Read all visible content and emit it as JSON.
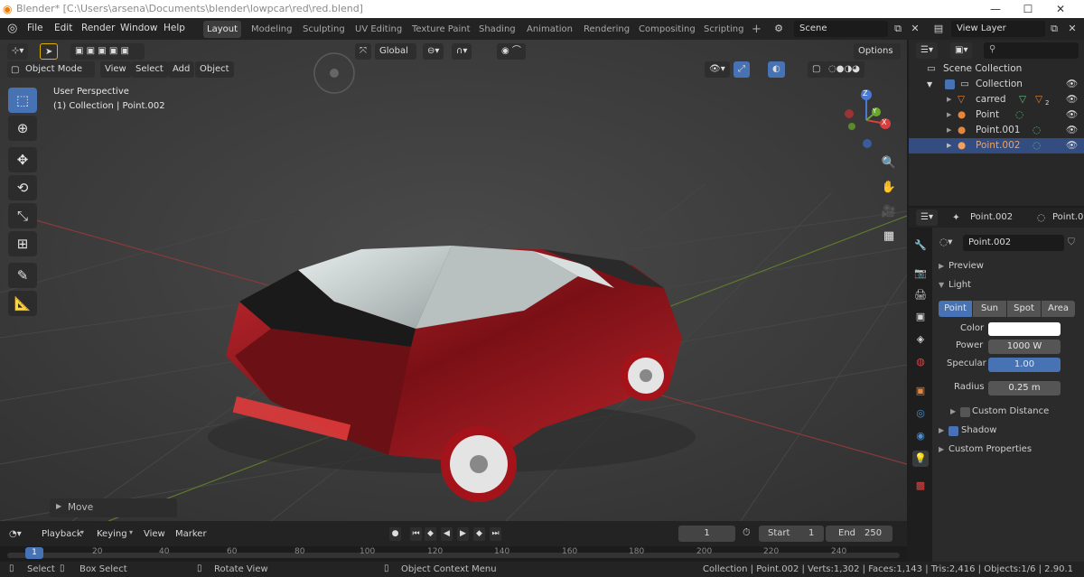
{
  "window": {
    "title": "Blender* [C:\\Users\\arsena\\Documents\\blender\\lowpcar\\red\\red.blend]",
    "controls": [
      "—",
      "☐",
      "✕"
    ]
  },
  "menu": [
    "File",
    "Edit",
    "Render",
    "Window",
    "Help"
  ],
  "workspaces": [
    "Layout",
    "Modeling",
    "Sculpting",
    "UV Editing",
    "Texture Paint",
    "Shading",
    "Animation",
    "Rendering",
    "Compositing",
    "Scripting"
  ],
  "workspace_add": "+",
  "scene": {
    "name": "Scene"
  },
  "view_layer": {
    "name": "View Layer"
  },
  "viewport": {
    "transform_orientation": "Global",
    "options_label": "Options",
    "mode": "Object Mode",
    "menu": [
      "View",
      "Select",
      "Add",
      "Object"
    ],
    "overlay_lines": [
      "User Perspective",
      "(1) Collection | Point.002"
    ],
    "operator_panel": "Move",
    "gizmo_axes": [
      "X",
      "Y",
      "Z"
    ]
  },
  "timeline": {
    "menu": [
      "Playback",
      "Keying",
      "View",
      "Marker"
    ],
    "current_frame": "1",
    "start_label": "Start",
    "start": "1",
    "end_label": "End",
    "end": "250",
    "ruler": [
      "1",
      "20",
      "40",
      "60",
      "80",
      "100",
      "120",
      "140",
      "160",
      "180",
      "200",
      "220",
      "240"
    ]
  },
  "statusbar": {
    "left": [
      "Select",
      "Box Select",
      "Rotate View",
      "Object Context Menu"
    ],
    "right": "Collection | Point.002 | Verts:1,302 | Faces:1,143 | Tris:2,416 | Objects:1/6 | 2.90.1"
  },
  "outliner": {
    "search_placeholder": "",
    "rows": [
      {
        "label": "Scene Collection",
        "indent": 0,
        "selected": false
      },
      {
        "label": "Collection",
        "indent": 1,
        "selected": false
      },
      {
        "label": "carred",
        "indent": 2,
        "selected": false,
        "badge": "2"
      },
      {
        "label": "Point",
        "indent": 2,
        "selected": false
      },
      {
        "label": "Point.001",
        "indent": 2,
        "selected": false
      },
      {
        "label": "Point.002",
        "indent": 2,
        "selected": true
      }
    ]
  },
  "properties": {
    "object_name": "Point.002",
    "object_name_cut": "Point.0",
    "data_name": "Point.002",
    "panels": {
      "preview": "Preview",
      "light": "Light",
      "custom_distance": "Custom Distance",
      "shadow": "Shadow",
      "custom_properties": "Custom Properties"
    },
    "light_types": [
      "Point",
      "Sun",
      "Spot",
      "Area"
    ],
    "active_light_type": "Point",
    "fields": {
      "color_label": "Color",
      "power_label": "Power",
      "power": "1000 W",
      "specular_label": "Specular",
      "specular": "1.00",
      "radius_label": "Radius",
      "radius": "0.25 m"
    },
    "colors": {
      "accent": "#4772b3",
      "selection": "#334d80",
      "car_body": "#9b1a1f"
    }
  }
}
